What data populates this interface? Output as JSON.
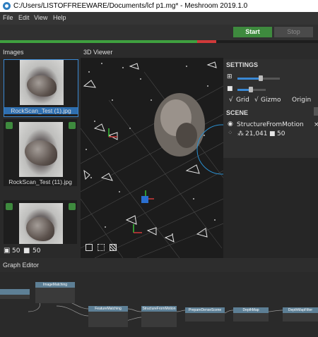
{
  "window": {
    "title": "C:/Users/LISTOFFREEWARE/Documents/lcf p1.mg* - Meshroom 2019.1.0"
  },
  "menu": {
    "items": [
      "File",
      "Edit",
      "View",
      "Help"
    ]
  },
  "toolbar": {
    "start_label": "Start",
    "stop_label": "Stop",
    "progress_done": 0.62,
    "progress_error": 0.06
  },
  "images": {
    "header": "Images",
    "items": [
      {
        "label": "RockScan_Test (1).jpg",
        "selected": true
      },
      {
        "label": "RockScan_Test (11).jpg",
        "selected": false
      },
      {
        "label": "",
        "selected": false
      }
    ],
    "footer": {
      "images_count": "50",
      "cameras_count": "50"
    }
  },
  "viewer": {
    "header": "3D Viewer"
  },
  "settings": {
    "header": "SETTINGS",
    "toggles": {
      "grid": "Grid",
      "gizmo": "Gizmo",
      "origin": "Origin"
    },
    "check": "√"
  },
  "scene": {
    "header": "SCENE",
    "item": {
      "name": "StructureFromMotion",
      "points": "21,041",
      "cameras": "50"
    }
  },
  "graph": {
    "header": "Graph Editor",
    "nodes": [
      "ImageMatching",
      "FeatureMatching",
      "StructureFromMotion",
      "PrepareDenseScene",
      "DepthMap",
      "DepthMapFilter"
    ]
  },
  "colors": {
    "accent": "#3a89d4",
    "start": "#3e8a3e",
    "error": "#d03a3a",
    "node": "#5d7f95"
  }
}
